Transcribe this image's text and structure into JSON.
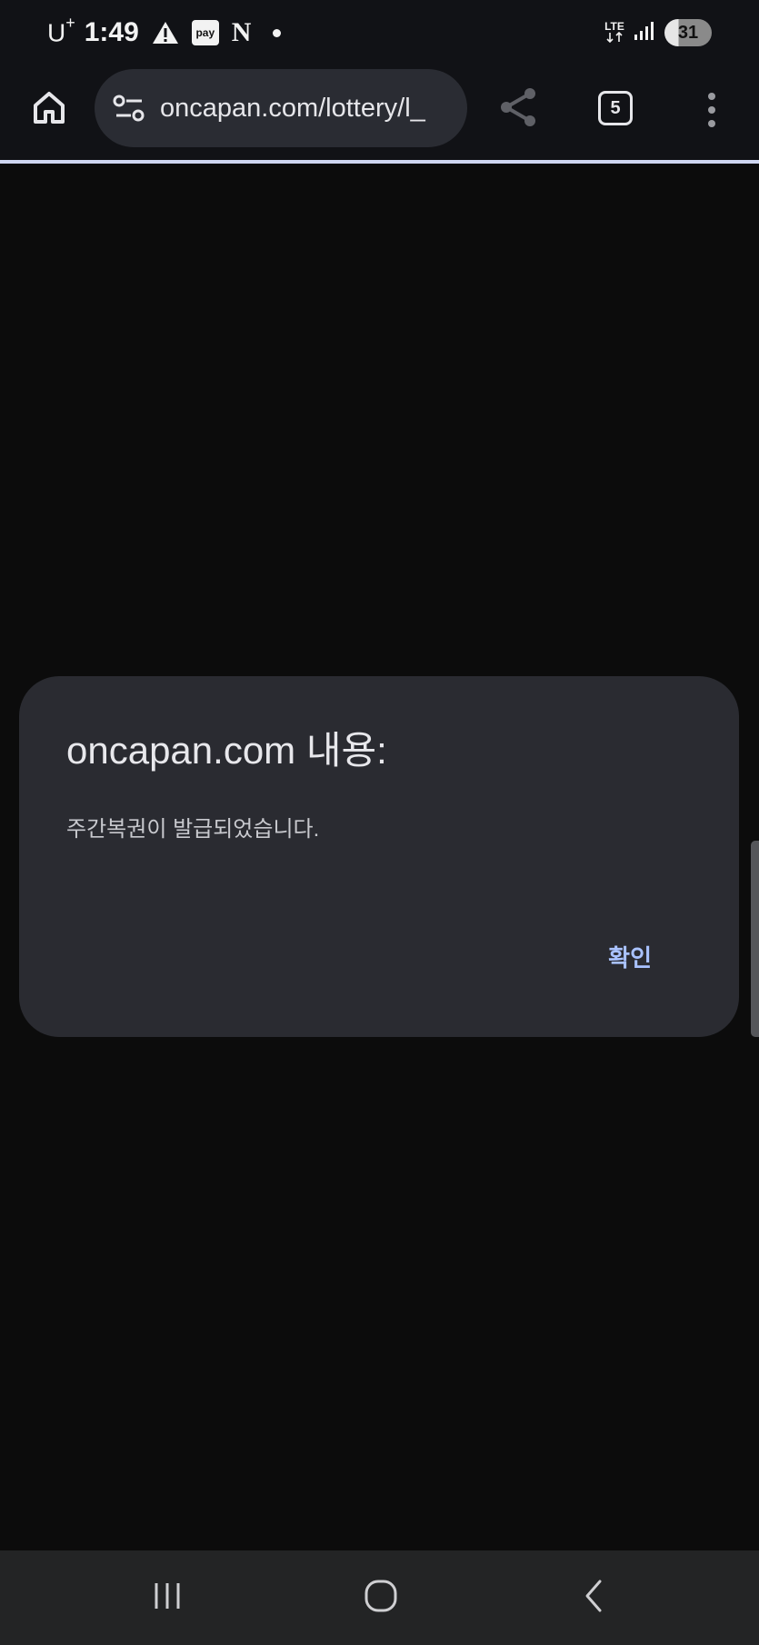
{
  "status_bar": {
    "carrier": "U",
    "carrier_sup": "+",
    "time": "1:49",
    "pay_badge": "pay",
    "netflix_badge": "N",
    "network": "LTE",
    "battery": "31"
  },
  "toolbar": {
    "url": "oncapan.com/lottery/l_",
    "tab_count": "5"
  },
  "dialog": {
    "title": "oncapan.com 내용:",
    "message": "주간복권이 발급되었습니다.",
    "ok_label": "확인"
  },
  "icons": {
    "home": "home-icon",
    "site_settings": "site-settings-icon",
    "share": "share-icon",
    "tabs": "tab-switcher-icon",
    "menu": "more-vert-icon",
    "recents": "recents-icon",
    "home_nav": "home-nav-icon",
    "back": "back-icon"
  },
  "colors": {
    "background": "#0c0c0c",
    "dialog": "#2a2b31",
    "accent": "#a9c2ff",
    "progress_line": "#cfd7f2"
  }
}
